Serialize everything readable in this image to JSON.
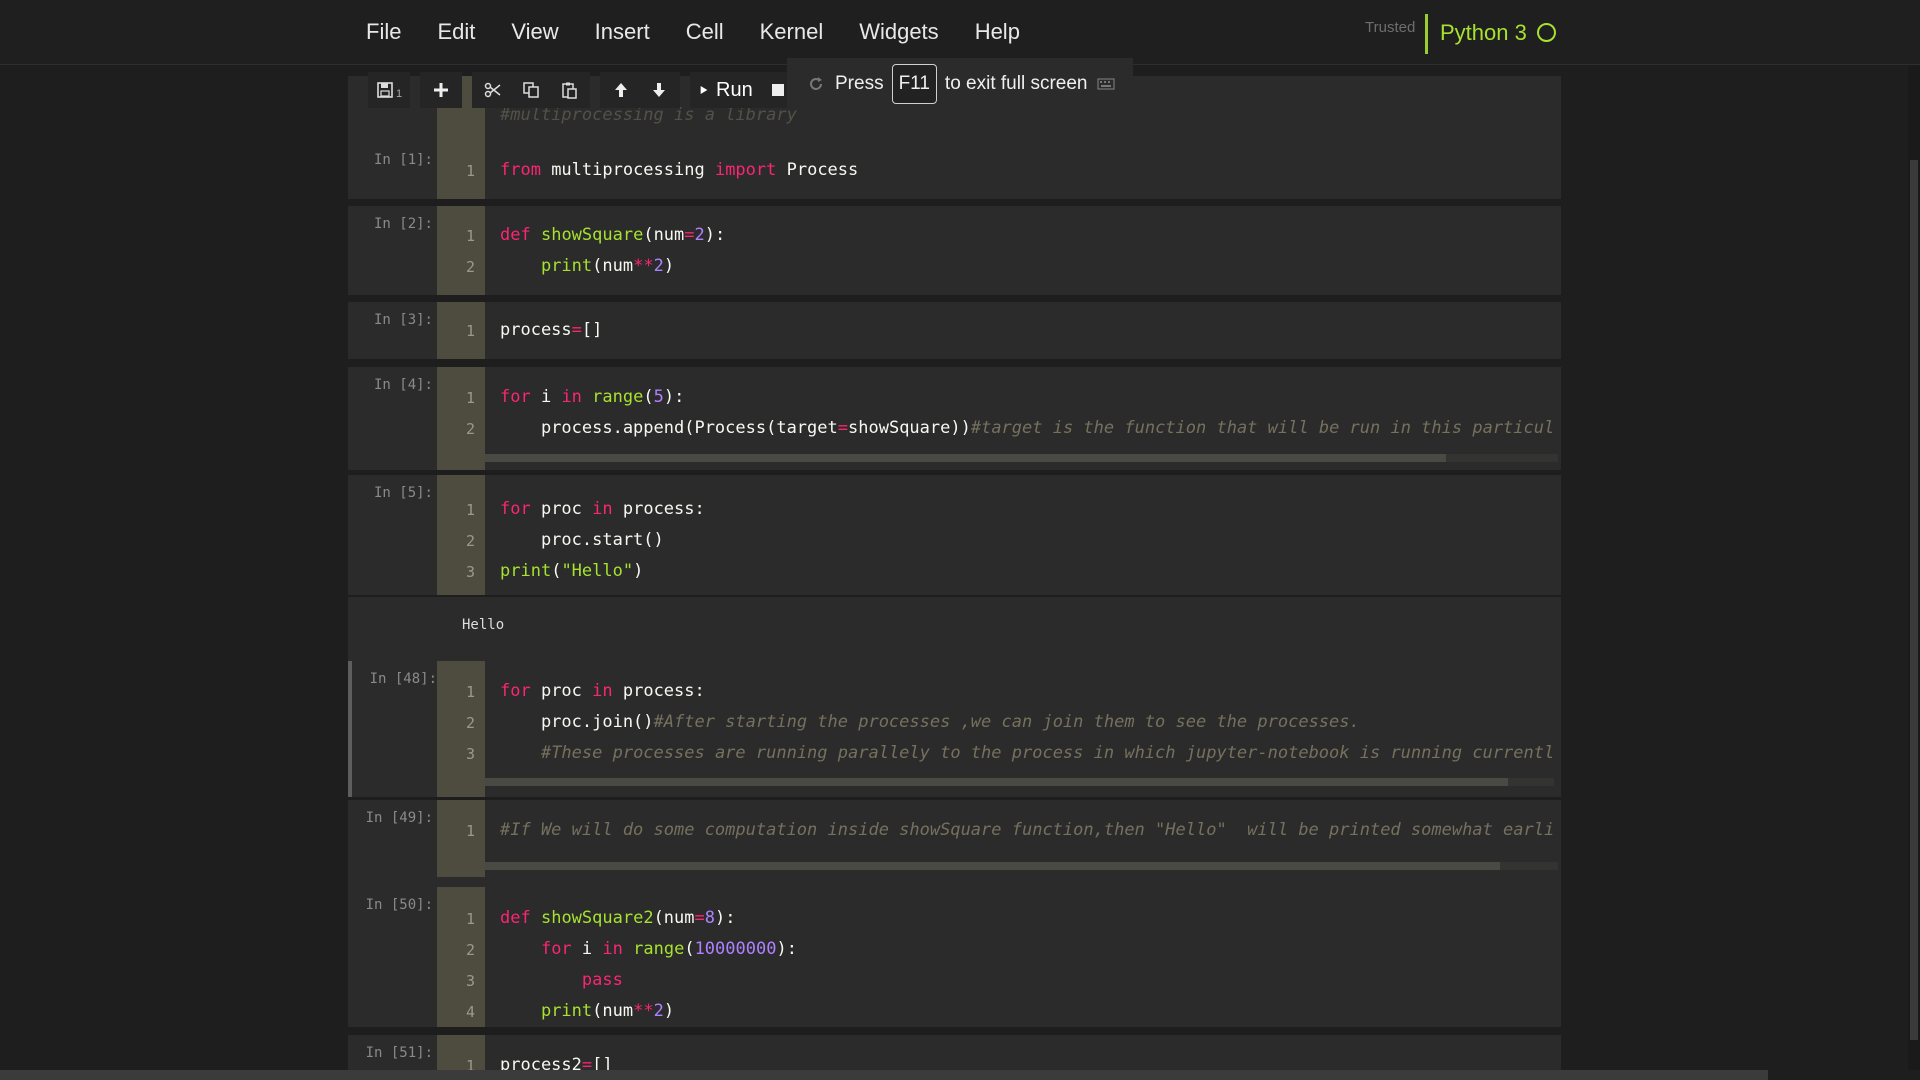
{
  "menu": [
    "File",
    "Edit",
    "View",
    "Insert",
    "Cell",
    "Kernel",
    "Widgets",
    "Help"
  ],
  "header": {
    "trusted": "Trusted",
    "kernel": "Python 3"
  },
  "toolbar": {
    "cell_counter": "1",
    "run_label": "Run"
  },
  "fullscreen_notice": {
    "press": "Press",
    "key": "F11",
    "rest": "to exit full screen"
  },
  "cells": {
    "c0": {
      "prompt": "",
      "line1": "#multiprocessing is a library"
    },
    "c1": {
      "prompt": "In [1]:"
    },
    "c2": {
      "prompt": "In [2]:"
    },
    "c3": {
      "prompt": "In [3]:"
    },
    "c4": {
      "prompt": "In [4]:",
      "comment": "#target is the function that will be run in this particul"
    },
    "c5": {
      "prompt": "In [5]:",
      "output": "Hello"
    },
    "c48": {
      "prompt": "In [48]:",
      "comment1": "#After starting the processes ,we can join them to see the processes.",
      "comment2": "#These processes are running parallely to the process in which jupyter-notebook is running currentl"
    },
    "c49": {
      "prompt": "In [49]:",
      "comment": "#If We will do some computation inside showSquare function,then \"Hello\"  will be printed somewhat earli"
    },
    "c50": {
      "prompt": "In [50]:"
    },
    "c51": {
      "prompt": "In [51]:"
    }
  },
  "colors": {
    "keyword": "#f92672",
    "function": "#a6e22e",
    "number": "#ae81ff",
    "comment": "#75715e",
    "kernel": "#a6e22e"
  }
}
